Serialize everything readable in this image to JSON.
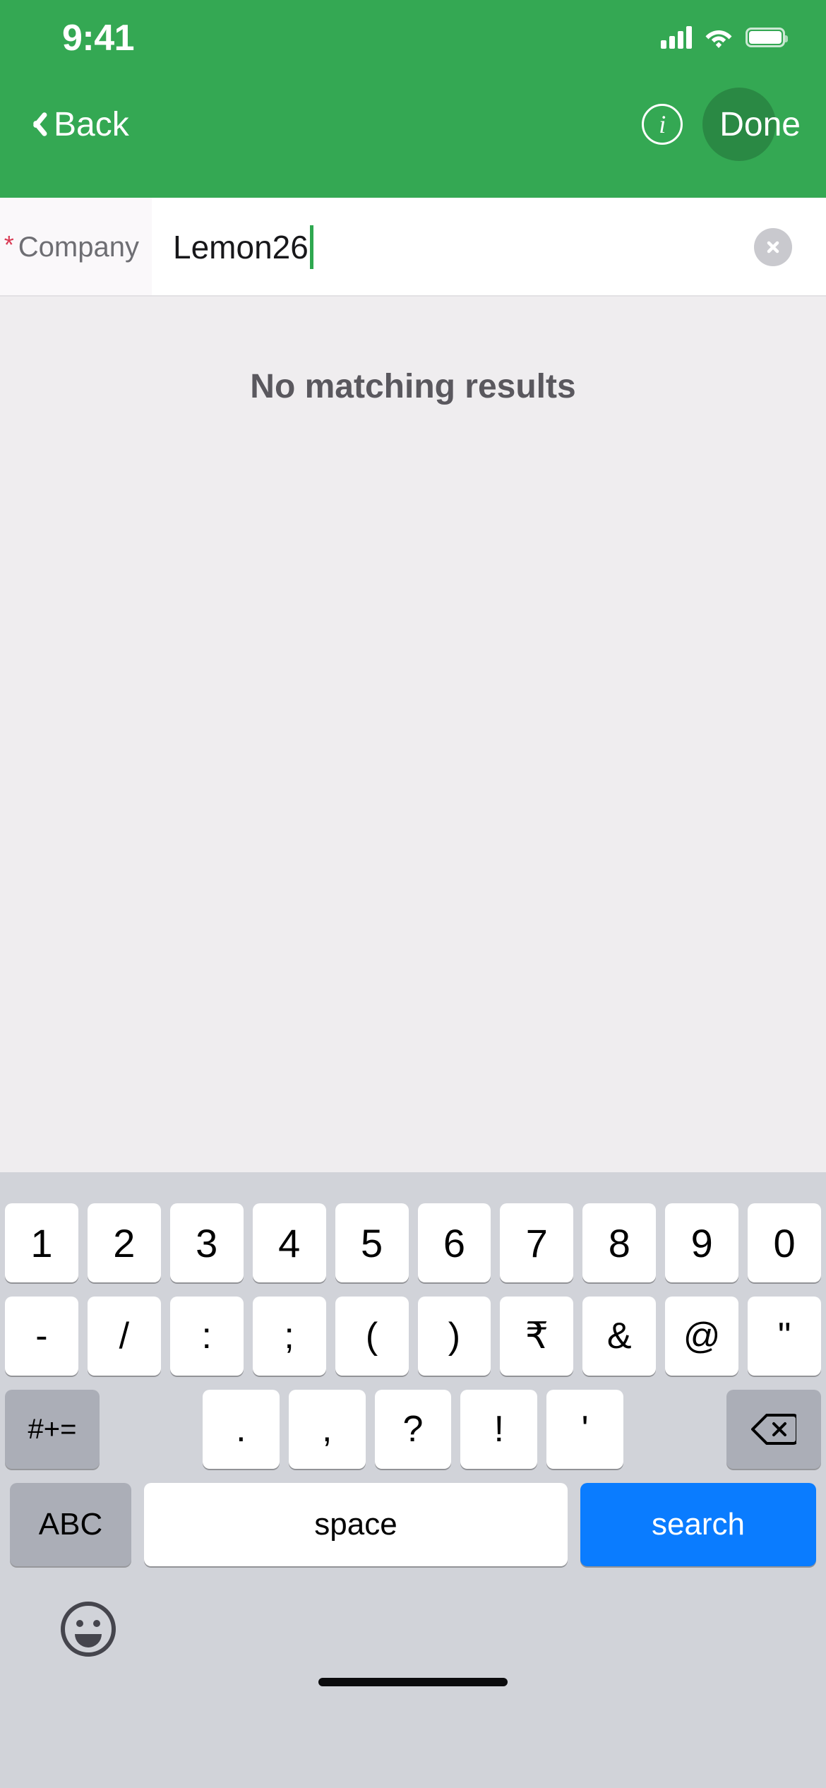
{
  "status_bar": {
    "time": "9:41",
    "signal_icon": "cellular-signal-icon",
    "wifi_icon": "wifi-icon",
    "battery_icon": "battery-icon"
  },
  "nav_bar": {
    "back_label": "Back",
    "back_icon": "chevron-left-icon",
    "info_icon": "info-circle-icon",
    "info_glyph": "i",
    "done_label": "Done",
    "background_color": "#34A853"
  },
  "field": {
    "required_marker": "*",
    "label": "Company",
    "value": "Lemon26",
    "clear_icon": "clear-circle-icon",
    "caret_color": "#2EA84F",
    "required_color": "#D93B54"
  },
  "results": {
    "empty_message": "No matching results"
  },
  "keyboard": {
    "accent_color": "#0A7CFF",
    "background_color": "#D1D3D9",
    "row1": [
      "1",
      "2",
      "3",
      "4",
      "5",
      "6",
      "7",
      "8",
      "9",
      "0"
    ],
    "row2": [
      "-",
      "/",
      ":",
      ";",
      "(",
      ")",
      "₹",
      "&",
      "@",
      "\""
    ],
    "row3": {
      "mod_label": "#+=",
      "keys": [
        ".",
        ",",
        "?",
        "!",
        "'"
      ],
      "delete_icon": "delete-backspace-icon"
    },
    "row4": {
      "abc_label": "ABC",
      "space_label": "space",
      "return_label": "search"
    },
    "emoji_icon": "emoji-smiley-icon",
    "home_indicator": "home-indicator"
  }
}
